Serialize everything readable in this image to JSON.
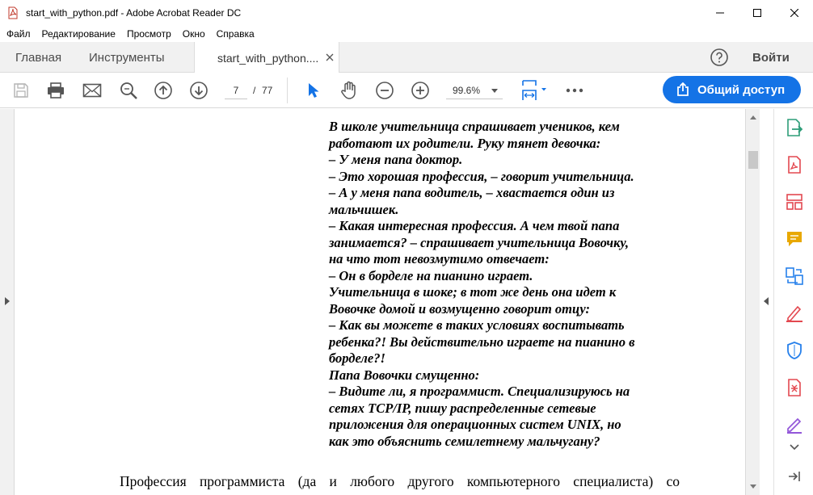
{
  "window": {
    "title": "start_with_python.pdf - Adobe Acrobat Reader DC"
  },
  "menu": {
    "items": [
      "Файл",
      "Редактирование",
      "Просмотр",
      "Окно",
      "Справка"
    ]
  },
  "tabs": {
    "home": "Главная",
    "tools": "Инструменты",
    "document": "start_with_python....",
    "signin": "Войти"
  },
  "toolbar": {
    "current_page": "7",
    "page_separator": "/",
    "total_pages": "77",
    "zoom": "99.6%",
    "share_label": "Общий доступ",
    "icons": [
      "save-icon",
      "print-icon",
      "email-icon",
      "search-icon",
      "page-up-icon",
      "page-down-icon",
      "select-cursor-icon",
      "hand-tool-icon",
      "zoom-out-icon",
      "zoom-in-icon",
      "page-fit-icon",
      "more-icon"
    ]
  },
  "document": {
    "joke_lines": [
      "В школе учительница спрашивает учеников, кем",
      "работают их родители. Руку тянет девочка:",
      "– У меня папа доктор.",
      "– Это хорошая профессия, – говорит учительница.",
      "– А у меня папа водитель, – хвастается один из",
      "мальчишек.",
      "– Какая интересная профессия. А чем твой папа",
      "занимается? – спрашивает учительница Вовочку,",
      "на что тот невозмутимо отвечает:",
      "– Он в борделе на пианино играет.",
      "Учительница в шоке; в тот же день она идет к",
      "Вовочке домой и возмущенно говорит отцу:",
      "– Как вы можете в таких условиях воспитывать",
      "ребенка?! Вы действительно играете на пианино в",
      "борделе?!",
      "Папа Вовочки смущенно:",
      "– Видите ли, я программист. Специализируюсь на",
      "сетях TCP/IP, пишу распределенные сетевые",
      "приложения для операционных систем UNIX, но",
      "как это объяснить семилетнему мальчугану?"
    ],
    "paragraph": "Профессия программиста (да и любого другого компьютерного специалиста) со"
  },
  "right_tools": {
    "icons": [
      "export-pdf-icon",
      "create-pdf-icon",
      "organize-pages-icon",
      "comment-icon",
      "combine-files-icon",
      "fill-sign-icon",
      "protect-icon",
      "compress-pdf-icon",
      "edit-pdf-icon",
      "expand-more-icon",
      "collapse-panel-icon"
    ]
  },
  "colors": {
    "accent": "#1473e6",
    "tools_red": "#e34850",
    "tools_purple": "#9256d9",
    "tools_blue": "#2680eb",
    "tools_green": "#2d9d78",
    "tools_yellow": "#e8a800"
  }
}
